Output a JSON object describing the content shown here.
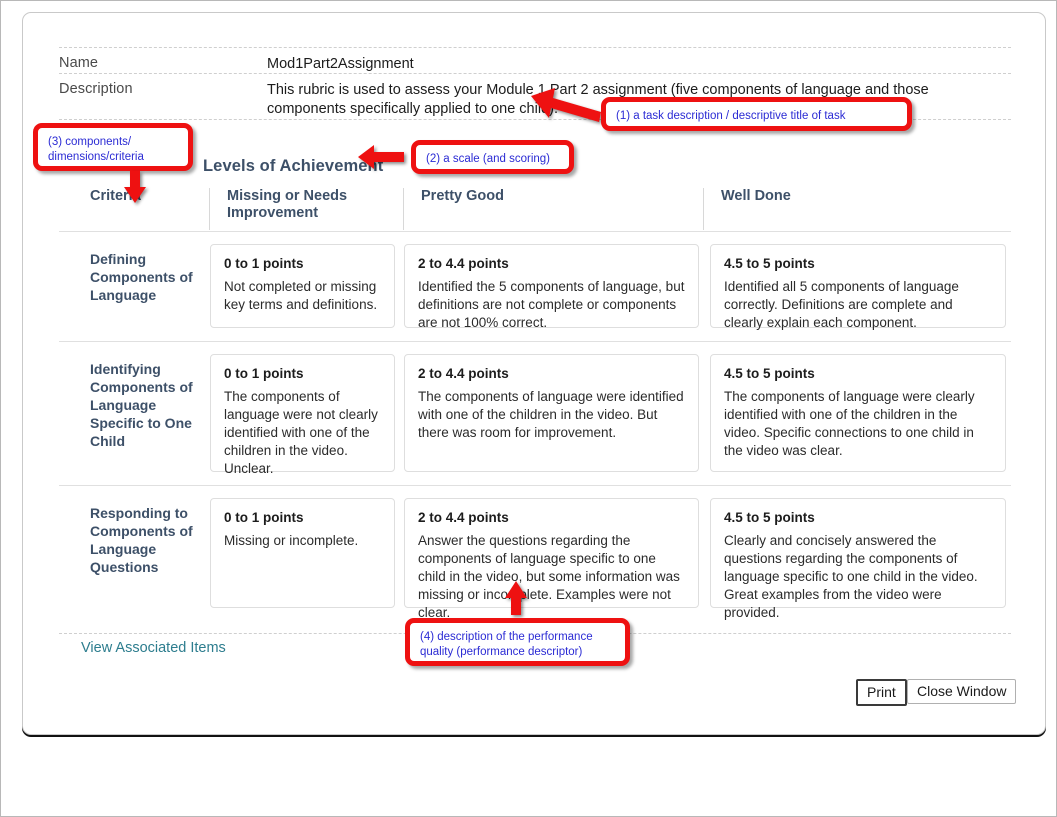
{
  "header": {
    "name_label": "Name",
    "name_value": "Mod1Part2Assignment",
    "description_label": "Description",
    "description_value": "This rubric is used to assess your Module 1 Part 2 assignment (five components of language and those components specifically applied to one child)."
  },
  "levels_title": "Levels of Achievement",
  "table": {
    "headers": {
      "criteria": "Criteria",
      "level1": "Missing or Needs Improvement",
      "level2": "Pretty Good",
      "level3": "Well Done"
    },
    "rows": [
      {
        "criterion": "Defining Components of Language",
        "cells": [
          {
            "points": "0 to 1 points",
            "description": "Not completed or missing key terms and definitions."
          },
          {
            "points": "2 to 4.4 points",
            "description": "Identified the 5 components of language, but definitions are not complete or components are not 100% correct."
          },
          {
            "points": "4.5 to 5 points",
            "description": "Identified all 5 components of language correctly. Definitions are complete and clearly explain each component."
          }
        ]
      },
      {
        "criterion": "Identifying Components of Language Specific to One Child",
        "cells": [
          {
            "points": "0 to 1 points",
            "description": "The components of language were not clearly identified with one of the children in the video. Unclear."
          },
          {
            "points": "2 to 4.4 points",
            "description": "The components of language were identified with one of the children in the video. But there was room for improvement."
          },
          {
            "points": "4.5 to 5 points",
            "description": "The components of language were clearly identified with one of the children in the video. Specific connections to one child in the video was clear."
          }
        ]
      },
      {
        "criterion": "Responding to Components of Language Questions",
        "cells": [
          {
            "points": "0 to 1 points",
            "description": "Missing or incomplete."
          },
          {
            "points": "2 to 4.4 points",
            "description": "Answer the questions regarding the components of language specific to one child in the video, but some information was missing or incomplete. Examples were not clear."
          },
          {
            "points": "4.5 to 5 points",
            "description": "Clearly and concisely answered the questions regarding the components of language specific to one child in the video. Great examples from the video were provided."
          }
        ]
      }
    ]
  },
  "footer": {
    "associated_items_link": "View Associated Items",
    "print_button": "Print",
    "close_button": "Close Window"
  },
  "annotations": {
    "one": "(1) a task description / descriptive title of task",
    "two": "(2) a scale (and scoring)",
    "three": "(3) components/ dimensions/criteria",
    "four": "(4) description of the performance quality (performance descriptor)"
  },
  "colors": {
    "annotation_border": "#ee1111",
    "annotation_text": "#2b2bd4",
    "heading_blue": "#3d5068",
    "link_teal": "#2d7d8e"
  }
}
